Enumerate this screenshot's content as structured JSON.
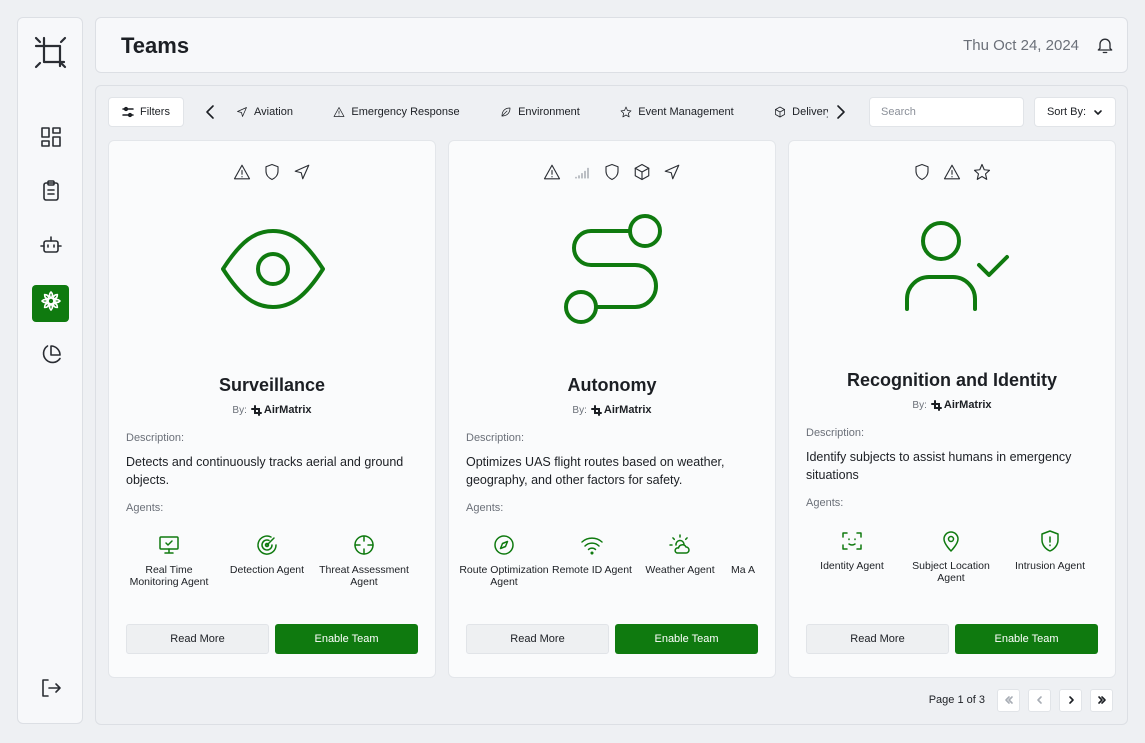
{
  "app": {
    "title": "Teams",
    "date": "Thu Oct 24, 2024"
  },
  "sidebar": {
    "items": [
      {
        "name": "dashboard",
        "icon": "grid-icon"
      },
      {
        "name": "tasks",
        "icon": "clipboard-icon"
      },
      {
        "name": "bots",
        "icon": "bot-icon"
      },
      {
        "name": "teams",
        "icon": "flower-icon",
        "active": true
      },
      {
        "name": "analytics",
        "icon": "pie-chart-icon"
      }
    ],
    "logout_icon": "logout-icon"
  },
  "toolbar": {
    "filters_label": "Filters",
    "categories": [
      {
        "label": "Aviation",
        "icon": "plane-icon"
      },
      {
        "label": "Emergency Response",
        "icon": "warning-icon"
      },
      {
        "label": "Environment",
        "icon": "leaf-icon"
      },
      {
        "label": "Event Management",
        "icon": "star-icon"
      },
      {
        "label": "Delivery",
        "icon": "package-icon"
      }
    ],
    "search_placeholder": "Search",
    "sort_label": "Sort By:"
  },
  "cards": [
    {
      "title": "Surveillance",
      "by_label": "By:",
      "author": "AirMatrix",
      "tags": [
        "warning-icon",
        "shield-icon",
        "plane-icon"
      ],
      "hero_icon": "eye-icon",
      "description_label": "Description:",
      "description": "Detects and continuously tracks aerial and ground objects.",
      "agents_label": "Agents:",
      "agents": [
        {
          "name": "Real Time Monitoring Agent",
          "icon": "monitor-icon"
        },
        {
          "name": "Detection Agent",
          "icon": "radar-icon"
        },
        {
          "name": "Threat Assessment Agent",
          "icon": "crosshair-icon"
        }
      ],
      "read_more": "Read More",
      "enable": "Enable Team"
    },
    {
      "title": "Autonomy",
      "by_label": "By:",
      "author": "AirMatrix",
      "tags": [
        "warning-icon",
        "signal-icon",
        "shield-icon",
        "package-icon",
        "plane-icon"
      ],
      "hero_icon": "route-icon",
      "description_label": "Description:",
      "description": "Optimizes UAS flight routes based on weather, geography, and other factors for safety.",
      "agents_label": "Agents:",
      "agents": [
        {
          "name": "Route Optimization Agent",
          "icon": "compass-icon"
        },
        {
          "name": "Remote ID Agent",
          "icon": "wifi-icon"
        },
        {
          "name": "Weather Agent",
          "icon": "sun-cloud-icon"
        },
        {
          "name": "Ma A",
          "icon": "unknown-icon"
        }
      ],
      "read_more": "Read More",
      "enable": "Enable Team"
    },
    {
      "title": "Recognition and Identity",
      "by_label": "By:",
      "author": "AirMatrix",
      "tags": [
        "shield-icon",
        "warning-icon",
        "star-icon"
      ],
      "hero_icon": "user-check-icon",
      "description_label": "Description:",
      "description": "Identify subjects to assist humans in emergency situations",
      "agents_label": "Agents:",
      "agents": [
        {
          "name": "Identity Agent",
          "icon": "face-scan-icon"
        },
        {
          "name": "Subject Location Agent",
          "icon": "map-pin-icon"
        },
        {
          "name": "Intrusion Agent",
          "icon": "shield-alert-icon"
        }
      ],
      "read_more": "Read More",
      "enable": "Enable Team"
    }
  ],
  "pagination": {
    "text": "Page 1 of 3"
  },
  "colors": {
    "accent": "#0f7a0f",
    "background": "#eef0f3",
    "card": "#fafbfc"
  }
}
